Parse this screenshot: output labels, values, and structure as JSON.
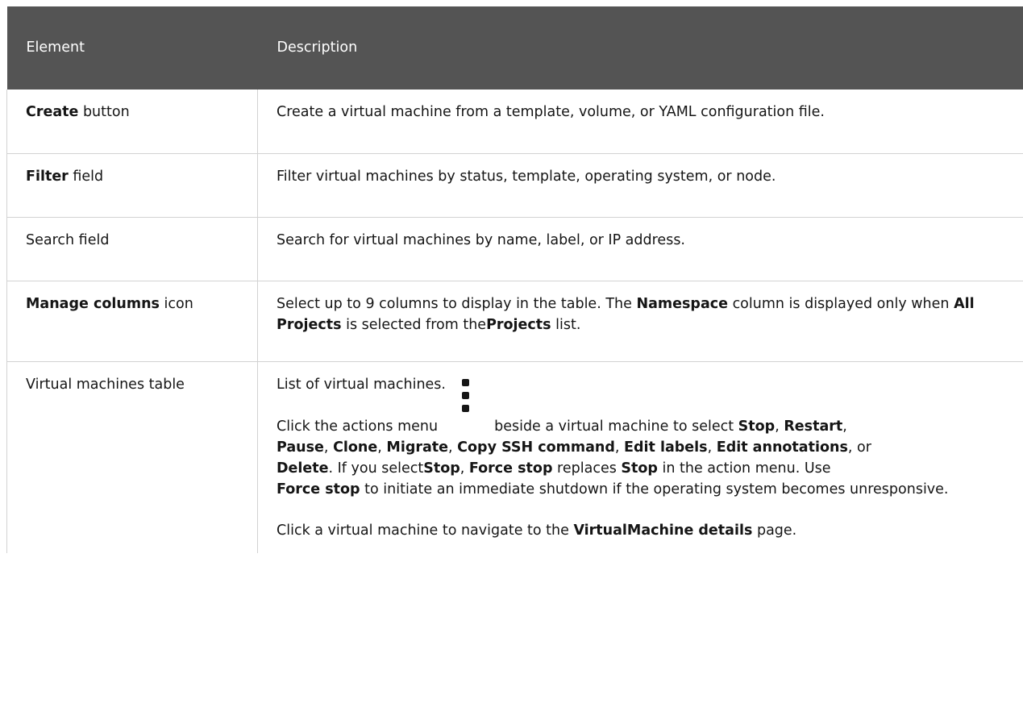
{
  "table": {
    "headers": [
      "Element",
      "Description"
    ],
    "rows": [
      {
        "element_strong": "Create",
        "element_rest": " button",
        "description": "Create a virtual machine from a template, volume, or YAML configuration file."
      },
      {
        "element_strong": "Filter",
        "element_rest": " field",
        "description": "Filter virtual machines by status, template, operating system, or node."
      },
      {
        "element_text": "Search field",
        "description": "Search for virtual machines by name, label, or IP address."
      },
      {
        "element_strong": "Manage columns",
        "element_rest": " icon",
        "desc_parts": [
          "Select up to 9 columns to display in the table. The ",
          "Namespace",
          " column is displayed only when ",
          "All Projects",
          " is selected from the",
          "Projects",
          " list."
        ]
      },
      {
        "element_text": "Virtual machines table",
        "p1": "List of virtual machines.",
        "p2_parts": [
          "Click the actions menu",
          "beside a virtual machine to select ",
          "Stop",
          ", ",
          "Restart",
          ",",
          "Pause",
          ", ",
          "Clone",
          ", ",
          "Migrate",
          ", ",
          "Copy SSH command",
          ", ",
          "Edit labels",
          ", ",
          "Edit annotations",
          ", or",
          "Delete",
          ". If you select",
          "Stop",
          ", ",
          "Force stop",
          " replaces ",
          "Stop",
          " in the action menu. Use",
          "Force stop",
          " to initiate an immediate shutdown if the operating system becomes unresponsive."
        ],
        "p3_parts": [
          "Click a virtual machine to navigate to the ",
          "VirtualMachine details",
          " page."
        ]
      }
    ]
  },
  "icons": {
    "actions_menu": "kebab-vertical-icon"
  }
}
